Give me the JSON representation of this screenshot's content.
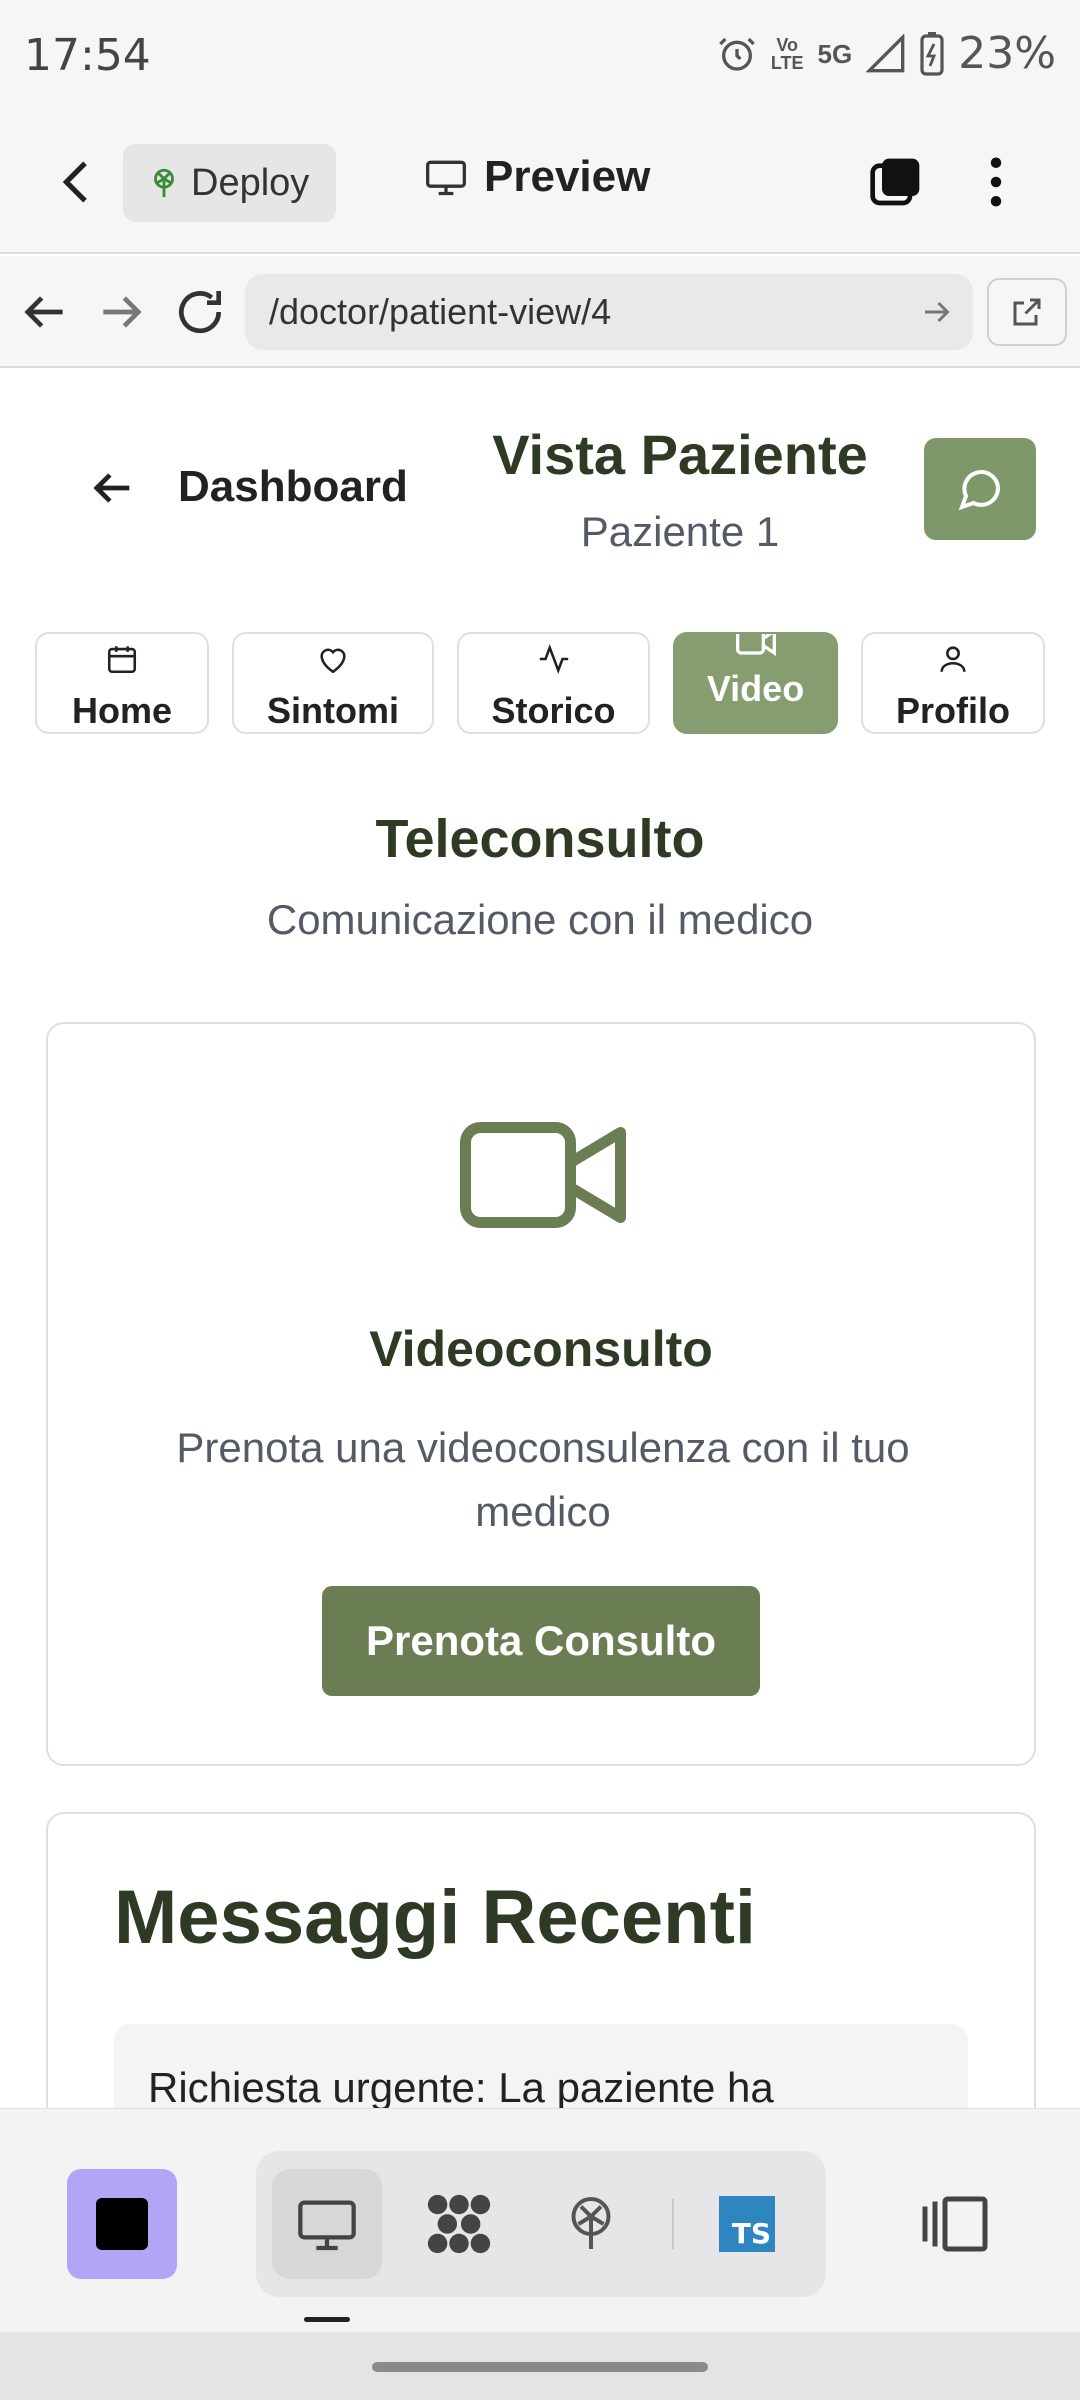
{
  "status_bar": {
    "time": "17:54",
    "network_top": "Vo",
    "network_bottom": "LTE",
    "signal_label": "5G",
    "battery": "23%"
  },
  "toolbar": {
    "deploy_label": "Deploy",
    "preview_label": "Preview"
  },
  "browser": {
    "url": "/doctor/patient-view/4"
  },
  "header": {
    "back_label": "Dashboard",
    "title": "Vista Paziente",
    "subtitle": "Paziente 1"
  },
  "tabs": [
    {
      "label": "Home",
      "icon": "calendar-icon"
    },
    {
      "label": "Sintomi",
      "icon": "heart-icon"
    },
    {
      "label": "Storico",
      "icon": "activity-icon"
    },
    {
      "label": "Video",
      "icon": "video-icon",
      "active": true
    },
    {
      "label": "Profilo",
      "icon": "user-icon"
    }
  ],
  "section": {
    "title": "Teleconsulto",
    "subtitle": "Comunicazione con il medico"
  },
  "video_card": {
    "title": "Videoconsulto",
    "description": "Prenota una videoconsulenza con il tuo medico",
    "button_label": "Prenota Consulto"
  },
  "messages": {
    "title": "Messaggi Recenti",
    "items": [
      {
        "text": "Richiesta urgente: La paziente ha"
      }
    ]
  },
  "bottom_tools": {
    "ts_label": "TS"
  },
  "colors": {
    "accent": "#7f986b",
    "accent_dark": "#6b7d52",
    "heading": "#2f3a24",
    "app_square": "#b4a4f7"
  }
}
